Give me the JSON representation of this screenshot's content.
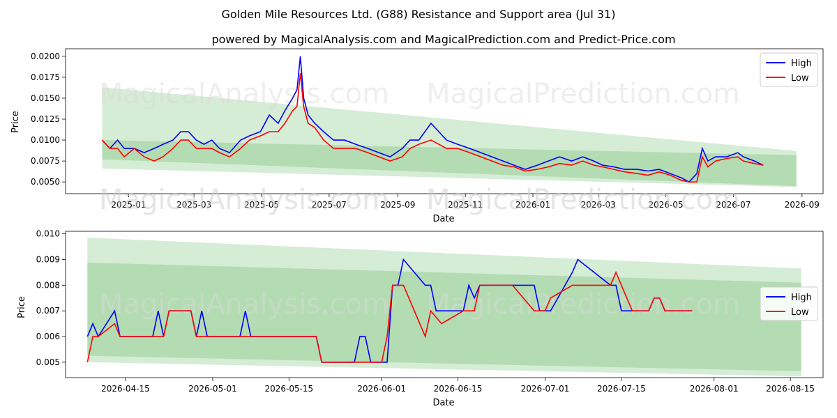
{
  "title": "Golden Mile Resources Ltd. (G88) Resistance and Support area (Jul 31)",
  "subtitle": "powered by MagicalAnalysis.com and MagicalPrediction.com and Predict-Price.com",
  "watermarks": [
    "MagicalAnalysis.com",
    "MagicalPrediction.com"
  ],
  "colors": {
    "high": "#0000ff",
    "low": "#ff0000",
    "band": "#2ca02c"
  },
  "chart_data": [
    {
      "type": "line",
      "xlabel": "Date",
      "ylabel": "Price",
      "xlim": [
        "2024-11-05",
        "2026-09-20"
      ],
      "ylim": [
        0.0036,
        0.0209
      ],
      "xticks": [
        "2025-01",
        "2025-03",
        "2025-05",
        "2025-07",
        "2025-09",
        "2025-11",
        "2026-01",
        "2026-03",
        "2026-05",
        "2026-07",
        "2026-09"
      ],
      "yticks": [
        "0.0050",
        "0.0075",
        "0.0100",
        "0.0125",
        "0.0150",
        "0.0175",
        "0.0200"
      ],
      "legend": "top-right",
      "bands": [
        {
          "x": [
            "2024-12-08",
            "2026-08-27"
          ],
          "upper": [
            0.0163,
            0.0087
          ],
          "lower": [
            0.0066,
            0.0044
          ],
          "opacity": 0.2
        },
        {
          "x": [
            "2024-12-08",
            "2026-08-27"
          ],
          "upper": [
            0.01,
            0.0082
          ],
          "lower": [
            0.0077,
            0.0045
          ],
          "opacity": 0.2
        }
      ],
      "series": [
        {
          "name": "High",
          "x": [
            "2024-12-08",
            "2024-12-15",
            "2024-12-22",
            "2024-12-28",
            "2025-01-06",
            "2025-01-15",
            "2025-01-24",
            "2025-02-01",
            "2025-02-10",
            "2025-02-17",
            "2025-02-24",
            "2025-03-03",
            "2025-03-10",
            "2025-03-17",
            "2025-03-24",
            "2025-04-02",
            "2025-04-12",
            "2025-04-20",
            "2025-04-30",
            "2025-05-08",
            "2025-05-16",
            "2025-05-22",
            "2025-05-29",
            "2025-06-02",
            "2025-06-05",
            "2025-06-08",
            "2025-06-12",
            "2025-06-18",
            "2025-06-26",
            "2025-07-05",
            "2025-07-15",
            "2025-07-25",
            "2025-08-05",
            "2025-08-15",
            "2025-08-25",
            "2025-09-05",
            "2025-09-12",
            "2025-09-20",
            "2025-10-01",
            "2025-10-08",
            "2025-10-15",
            "2025-10-25",
            "2025-11-05",
            "2025-11-15",
            "2025-11-25",
            "2025-12-05",
            "2025-12-15",
            "2025-12-25",
            "2026-01-05",
            "2026-01-15",
            "2026-01-25",
            "2026-02-05",
            "2026-02-15",
            "2026-02-25",
            "2026-03-05",
            "2026-03-15",
            "2026-03-25",
            "2026-04-05",
            "2026-04-15",
            "2026-04-25",
            "2026-05-05",
            "2026-05-15",
            "2026-05-22",
            "2026-05-29",
            "2026-06-03",
            "2026-06-08",
            "2026-06-15",
            "2026-06-25",
            "2026-07-05",
            "2026-07-10",
            "2026-07-20",
            "2026-07-28"
          ],
          "values": [
            0.01,
            0.009,
            0.01,
            0.009,
            0.009,
            0.0085,
            0.009,
            0.0095,
            0.01,
            0.011,
            0.011,
            0.01,
            0.0095,
            0.01,
            0.009,
            0.0085,
            0.01,
            0.0105,
            0.011,
            0.013,
            0.012,
            0.0135,
            0.015,
            0.016,
            0.02,
            0.015,
            0.013,
            0.012,
            0.011,
            0.01,
            0.01,
            0.0095,
            0.009,
            0.0085,
            0.008,
            0.009,
            0.01,
            0.01,
            0.012,
            0.011,
            0.01,
            0.0095,
            0.009,
            0.0085,
            0.008,
            0.0075,
            0.007,
            0.0065,
            0.007,
            0.0075,
            0.008,
            0.0075,
            0.008,
            0.0075,
            0.007,
            0.0068,
            0.0065,
            0.0065,
            0.0063,
            0.0065,
            0.006,
            0.0055,
            0.005,
            0.006,
            0.009,
            0.0075,
            0.008,
            0.008,
            0.0085,
            0.008,
            0.0075,
            0.007
          ]
        },
        {
          "name": "Low",
          "x": [
            "2024-12-08",
            "2024-12-15",
            "2024-12-22",
            "2024-12-28",
            "2025-01-06",
            "2025-01-15",
            "2025-01-24",
            "2025-02-01",
            "2025-02-10",
            "2025-02-17",
            "2025-02-24",
            "2025-03-03",
            "2025-03-10",
            "2025-03-17",
            "2025-03-24",
            "2025-04-02",
            "2025-04-12",
            "2025-04-20",
            "2025-04-30",
            "2025-05-08",
            "2025-05-16",
            "2025-05-22",
            "2025-05-29",
            "2025-06-02",
            "2025-06-05",
            "2025-06-08",
            "2025-06-12",
            "2025-06-18",
            "2025-06-26",
            "2025-07-05",
            "2025-07-15",
            "2025-07-25",
            "2025-08-05",
            "2025-08-15",
            "2025-08-25",
            "2025-09-05",
            "2025-09-12",
            "2025-09-20",
            "2025-10-01",
            "2025-10-08",
            "2025-10-15",
            "2025-10-25",
            "2025-11-05",
            "2025-11-15",
            "2025-11-25",
            "2025-12-05",
            "2025-12-15",
            "2025-12-25",
            "2026-01-05",
            "2026-01-15",
            "2026-01-25",
            "2026-02-05",
            "2026-02-15",
            "2026-02-25",
            "2026-03-05",
            "2026-03-15",
            "2026-03-25",
            "2026-04-05",
            "2026-04-15",
            "2026-04-25",
            "2026-05-05",
            "2026-05-15",
            "2026-05-22",
            "2026-05-29",
            "2026-06-03",
            "2026-06-08",
            "2026-06-15",
            "2026-06-25",
            "2026-07-05",
            "2026-07-10",
            "2026-07-20",
            "2026-07-28"
          ],
          "values": [
            0.01,
            0.009,
            0.009,
            0.008,
            0.009,
            0.008,
            0.0075,
            0.008,
            0.009,
            0.01,
            0.01,
            0.009,
            0.009,
            0.009,
            0.0085,
            0.008,
            0.009,
            0.01,
            0.0105,
            0.011,
            0.011,
            0.012,
            0.0135,
            0.014,
            0.018,
            0.014,
            0.012,
            0.0115,
            0.01,
            0.009,
            0.009,
            0.009,
            0.0085,
            0.008,
            0.0075,
            0.008,
            0.009,
            0.0095,
            0.01,
            0.0095,
            0.009,
            0.009,
            0.0085,
            0.008,
            0.0075,
            0.007,
            0.0068,
            0.0063,
            0.0065,
            0.0068,
            0.0072,
            0.007,
            0.0075,
            0.007,
            0.0068,
            0.0065,
            0.0062,
            0.006,
            0.0058,
            0.0062,
            0.0058,
            0.0052,
            0.005,
            0.005,
            0.008,
            0.0068,
            0.0075,
            0.0078,
            0.008,
            0.0075,
            0.0072,
            0.007
          ]
        }
      ]
    },
    {
      "type": "line",
      "xlabel": "Date",
      "ylabel": "Price",
      "xlim": [
        "2026-04-04",
        "2026-08-21"
      ],
      "ylim": [
        0.0044,
        0.0101
      ],
      "xticks": [
        "2026-04-15",
        "2026-05-01",
        "2026-05-15",
        "2026-06-01",
        "2026-06-15",
        "2026-07-01",
        "2026-07-15",
        "2026-08-01",
        "2026-08-15"
      ],
      "yticks": [
        "0.005",
        "0.006",
        "0.007",
        "0.008",
        "0.009",
        "0.010"
      ],
      "legend": "center-right",
      "bands": [
        {
          "x": [
            "2026-04-08",
            "2026-08-17"
          ],
          "upper": [
            0.00985,
            0.00865
          ],
          "lower": [
            0.005,
            0.00445
          ],
          "opacity": 0.2
        },
        {
          "x": [
            "2026-04-08",
            "2026-08-17"
          ],
          "upper": [
            0.00888,
            0.0081
          ],
          "lower": [
            0.00525,
            0.00465
          ],
          "opacity": 0.2
        }
      ],
      "series": [
        {
          "name": "High",
          "x": [
            "2026-04-08",
            "2026-04-09",
            "2026-04-10",
            "2026-04-13",
            "2026-04-14",
            "2026-04-20",
            "2026-04-21",
            "2026-04-22",
            "2026-04-23",
            "2026-04-27",
            "2026-04-28",
            "2026-04-29",
            "2026-04-30",
            "2026-05-06",
            "2026-05-07",
            "2026-05-08",
            "2026-05-20",
            "2026-05-21",
            "2026-05-27",
            "2026-05-28",
            "2026-05-29",
            "2026-05-30",
            "2026-06-02",
            "2026-06-03",
            "2026-06-04",
            "2026-06-05",
            "2026-06-09",
            "2026-06-10",
            "2026-06-11",
            "2026-06-16",
            "2026-06-17",
            "2026-06-18",
            "2026-06-19",
            "2026-06-25",
            "2026-06-26",
            "2026-06-29",
            "2026-06-30",
            "2026-07-01",
            "2026-07-02",
            "2026-07-06",
            "2026-07-07",
            "2026-07-13",
            "2026-07-14",
            "2026-07-15",
            "2026-07-17",
            "2026-07-20",
            "2026-07-21",
            "2026-07-22",
            "2026-07-23",
            "2026-07-28"
          ],
          "values": [
            0.006,
            0.0065,
            0.006,
            0.007,
            0.006,
            0.006,
            0.007,
            0.006,
            0.007,
            0.007,
            0.006,
            0.007,
            0.006,
            0.006,
            0.007,
            0.006,
            0.006,
            0.005,
            0.005,
            0.006,
            0.006,
            0.005,
            0.005,
            0.008,
            0.008,
            0.009,
            0.008,
            0.008,
            0.007,
            0.007,
            0.008,
            0.0075,
            0.008,
            0.008,
            0.008,
            0.008,
            0.007,
            0.007,
            0.007,
            0.0085,
            0.009,
            0.008,
            0.008,
            0.007,
            0.007,
            0.007,
            0.0075,
            0.0075,
            0.007,
            0.007
          ]
        },
        {
          "name": "Low",
          "x": [
            "2026-04-08",
            "2026-04-09",
            "2026-04-10",
            "2026-04-13",
            "2026-04-14",
            "2026-04-20",
            "2026-04-21",
            "2026-04-22",
            "2026-04-23",
            "2026-04-27",
            "2026-04-28",
            "2026-05-20",
            "2026-05-21",
            "2026-06-01",
            "2026-06-02",
            "2026-06-03",
            "2026-06-05",
            "2026-06-09",
            "2026-06-10",
            "2026-06-12",
            "2026-06-16",
            "2026-06-18",
            "2026-06-19",
            "2026-06-25",
            "2026-06-29",
            "2026-07-01",
            "2026-07-02",
            "2026-07-06",
            "2026-07-13",
            "2026-07-14",
            "2026-07-15",
            "2026-07-17",
            "2026-07-20",
            "2026-07-21",
            "2026-07-22",
            "2026-07-23",
            "2026-07-28"
          ],
          "values": [
            0.005,
            0.006,
            0.006,
            0.0065,
            0.006,
            0.006,
            0.006,
            0.006,
            0.007,
            0.007,
            0.006,
            0.006,
            0.005,
            0.005,
            0.006,
            0.008,
            0.008,
            0.006,
            0.007,
            0.0065,
            0.007,
            0.007,
            0.008,
            0.008,
            0.007,
            0.007,
            0.0075,
            0.008,
            0.008,
            0.0085,
            0.008,
            0.007,
            0.007,
            0.0075,
            0.0075,
            0.007,
            0.007
          ]
        }
      ]
    }
  ]
}
